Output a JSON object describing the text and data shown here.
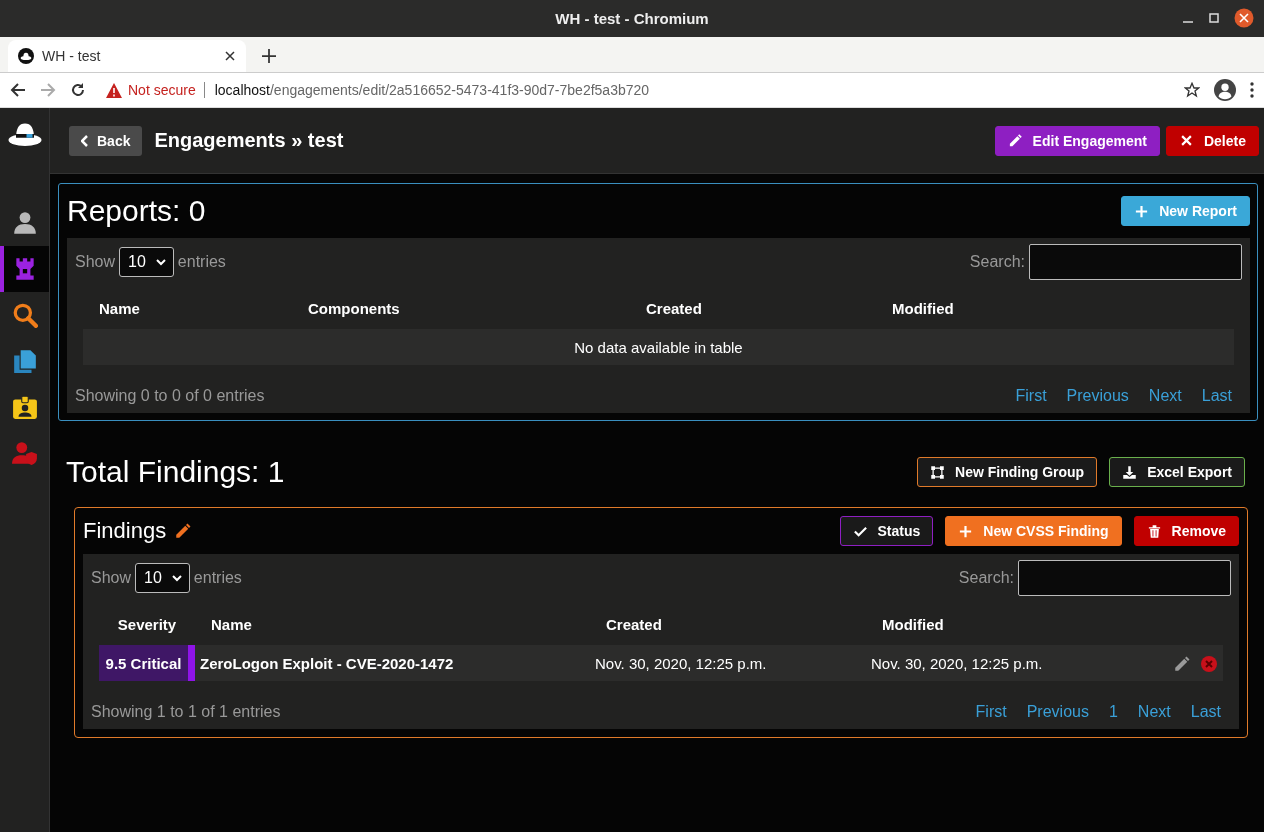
{
  "window": {
    "title": "WH - test - Chromium"
  },
  "browser": {
    "tab": {
      "title": "WH - test"
    },
    "address": {
      "security": "Not secure",
      "host": "localhost",
      "path": "/engagements/edit/2a516652-5473-41f3-90d7-7be2f5a3b720"
    }
  },
  "sidebar": {
    "items": [
      {
        "kind": "user",
        "selected": false
      },
      {
        "kind": "castle",
        "selected": true
      },
      {
        "kind": "search",
        "selected": false
      },
      {
        "kind": "copy",
        "selected": false
      },
      {
        "kind": "badge",
        "selected": false
      },
      {
        "kind": "shield-user",
        "selected": false
      }
    ]
  },
  "header": {
    "back_button": "Back",
    "title": "Engagements » test",
    "buttons": [
      {
        "kind": "edit",
        "label": "Edit Engagement"
      },
      {
        "kind": "delete",
        "label": "Delete"
      }
    ]
  },
  "reports": {
    "title": "Reports: 0",
    "buttons": [
      {
        "kind": "new-report",
        "label": "New Report"
      }
    ],
    "table": {
      "show_label": "Show",
      "page_size": "10",
      "entries_label": "entries",
      "search_label": "Search:",
      "columns": [
        "Name",
        "Components",
        "Created",
        "Modified"
      ],
      "empty_message": "No data available in table",
      "info": "Showing 0 to 0 of 0 entries",
      "pagination": [
        "First",
        "Previous",
        "Next",
        "Last"
      ]
    }
  },
  "findings": {
    "title": "Total Findings: 1",
    "buttons": [
      {
        "kind": "group",
        "label": "New Finding Group"
      },
      {
        "kind": "export",
        "label": "Excel Export"
      }
    ],
    "panel": {
      "title": "Findings",
      "buttons": [
        {
          "kind": "status",
          "label": "Status"
        },
        {
          "kind": "new-cvss",
          "label": "New CVSS Finding"
        },
        {
          "kind": "remove",
          "label": "Remove"
        }
      ],
      "table": {
        "show_label": "Show",
        "page_size": "10",
        "entries_label": "entries",
        "search_label": "Search:",
        "columns": [
          "Severity",
          "Name",
          "Created",
          "Modified"
        ],
        "rows": [
          {
            "severity": "9.5 Critical",
            "color": "#8f14e8",
            "name": "ZeroLogon Exploit - CVE-2020-1472",
            "created": "Nov. 30, 2020, 12:25 p.m.",
            "modified": "Nov. 30, 2020, 12:25 p.m."
          }
        ],
        "info": "Showing 1 to 1 of 1 entries",
        "pagination": [
          "First",
          "Previous",
          "1",
          "Next",
          "Last"
        ]
      }
    }
  }
}
